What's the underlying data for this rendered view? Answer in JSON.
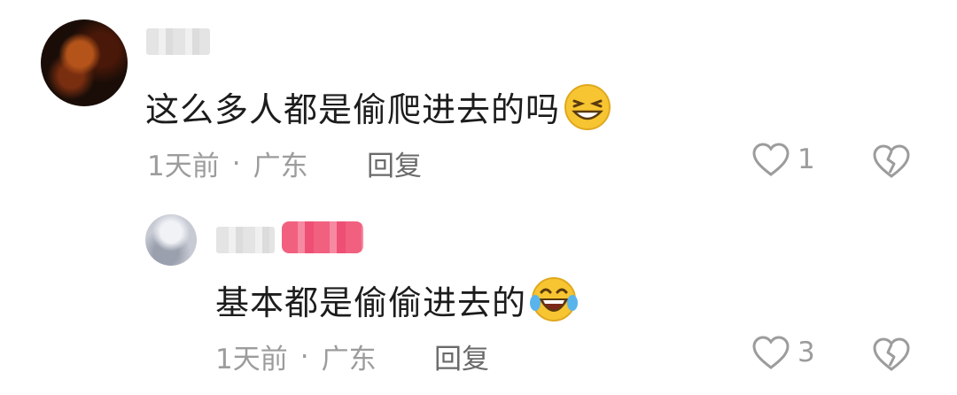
{
  "comments": [
    {
      "text": "这么多人都是偷爬进去的吗",
      "emoji": "grinning-squint-emoji",
      "time": "1天前",
      "location": "广东",
      "reply_label": "回复",
      "like_count": "1"
    },
    {
      "text": "基本都是偷偷进去的",
      "emoji": "laughing-tears-emoji",
      "time": "1天前",
      "location": "广东",
      "reply_label": "回复",
      "like_count": "3"
    }
  ],
  "separator": "·"
}
